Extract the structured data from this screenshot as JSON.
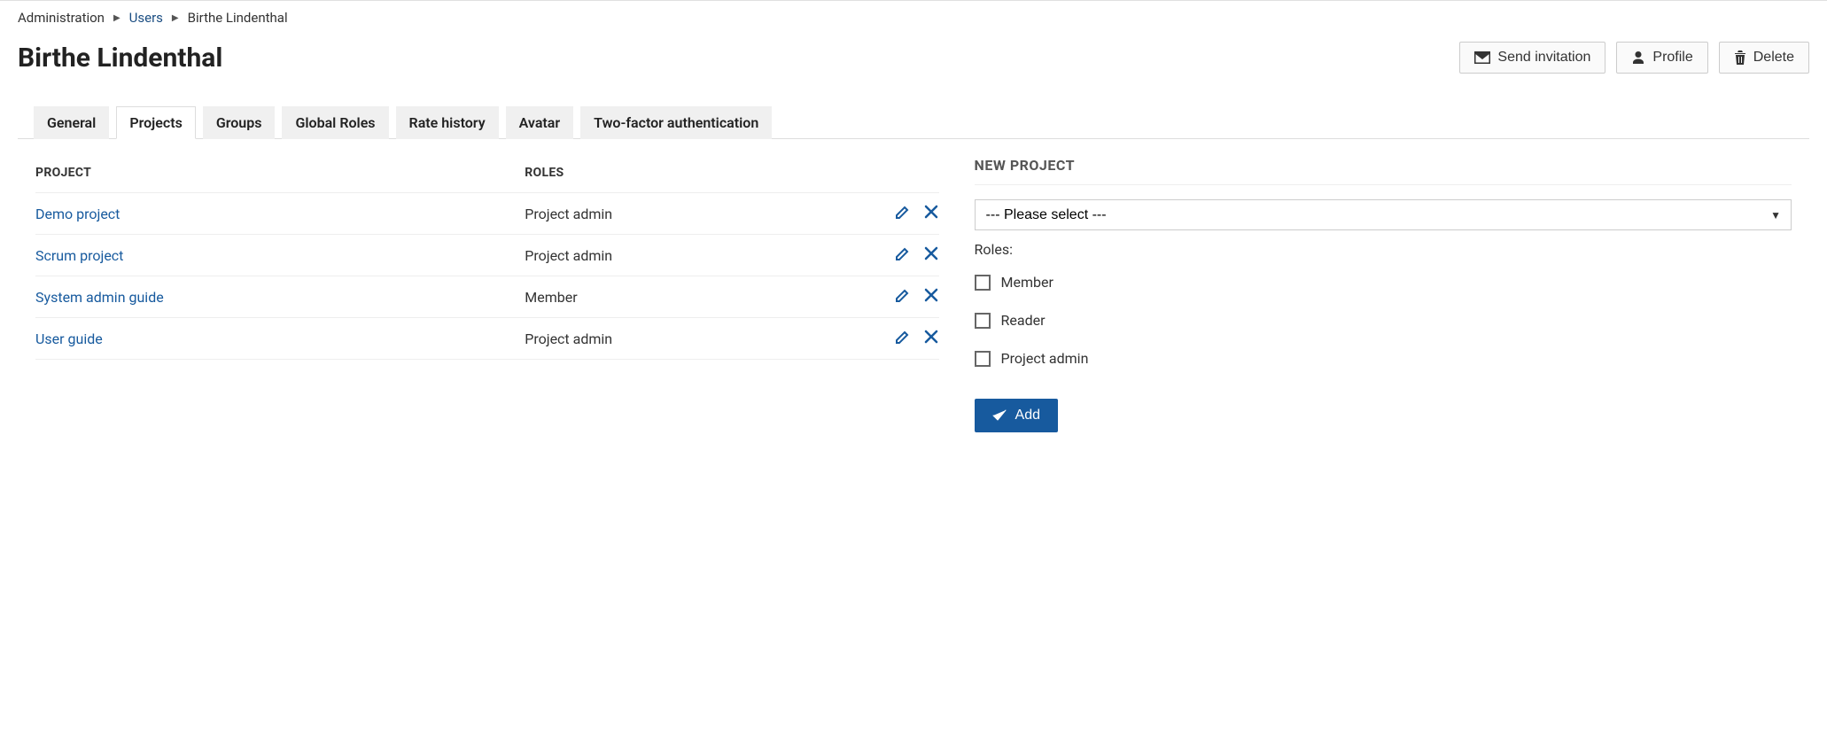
{
  "breadcrumb": {
    "admin": "Administration",
    "users": "Users",
    "current": "Birthe Lindenthal"
  },
  "page_title": "Birthe Lindenthal",
  "header_actions": {
    "send_invitation": "Send invitation",
    "profile": "Profile",
    "delete": "Delete"
  },
  "tabs": [
    {
      "label": "General",
      "active": false
    },
    {
      "label": "Projects",
      "active": true
    },
    {
      "label": "Groups",
      "active": false
    },
    {
      "label": "Global Roles",
      "active": false
    },
    {
      "label": "Rate history",
      "active": false
    },
    {
      "label": "Avatar",
      "active": false
    },
    {
      "label": "Two-factor authentication",
      "active": false
    }
  ],
  "table": {
    "headers": {
      "project": "PROJECT",
      "roles": "ROLES"
    },
    "rows": [
      {
        "project": "Demo project",
        "role": "Project admin"
      },
      {
        "project": "Scrum project",
        "role": "Project admin"
      },
      {
        "project": "System admin guide",
        "role": "Member"
      },
      {
        "project": "User guide",
        "role": "Project admin"
      }
    ]
  },
  "new_project_panel": {
    "title": "NEW PROJECT",
    "select_placeholder": "--- Please select ---",
    "roles_label": "Roles:",
    "roles": [
      {
        "label": "Member"
      },
      {
        "label": "Reader"
      },
      {
        "label": "Project admin"
      }
    ],
    "add_button": "Add"
  }
}
